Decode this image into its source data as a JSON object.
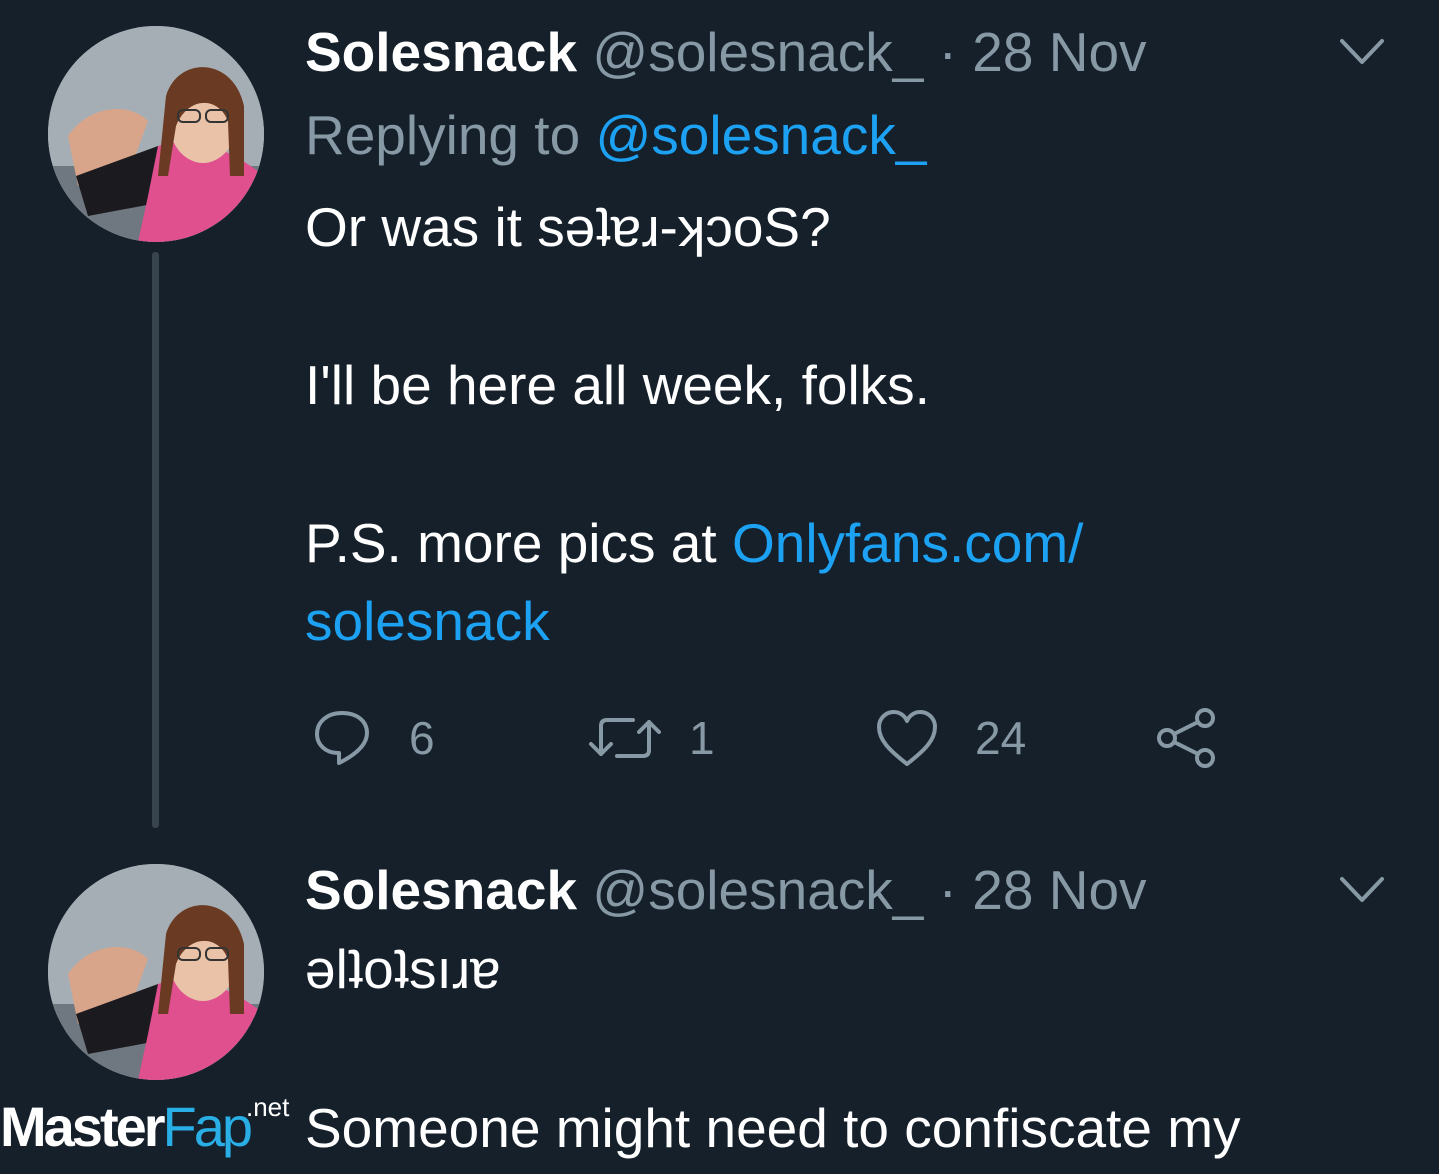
{
  "colors": {
    "background": "#15202b",
    "text_primary": "#ffffff",
    "text_secondary": "#8899a6",
    "link": "#1da1f2",
    "thread_line": "#38444d"
  },
  "tweets": [
    {
      "author_name": "Solesnack",
      "handle": "@solesnack_",
      "separator": "·",
      "date": "28 Nov",
      "replying_prefix": "Replying to",
      "replying_handle": "@solesnack_",
      "body_line1": "Or was it sǝʇɐɹ-ʞɔoS?",
      "body_line2": "I'll be here all week, folks.",
      "body_line3_prefix": "P.S. more pics at",
      "body_link_part1": "Onlyfans.com/",
      "body_link_part2": "solesnack",
      "reply_icon": "reply-icon",
      "reply_count": "6",
      "retweet_icon": "retweet-icon",
      "retweet_count": "1",
      "like_icon": "heart-icon",
      "like_count": "24",
      "share_icon": "share-icon",
      "menu_icon": "chevron-down-icon"
    },
    {
      "author_name": "Solesnack",
      "handle": "@solesnack_",
      "separator": "·",
      "date": "28 Nov",
      "body_line1": "ǝlʇoʇsıɹɐ",
      "body_line2": "Someone might need to confiscate my",
      "menu_icon": "chevron-down-icon"
    }
  ],
  "watermark": {
    "master": "Master",
    "fap": "Fap",
    "net": ".net"
  }
}
